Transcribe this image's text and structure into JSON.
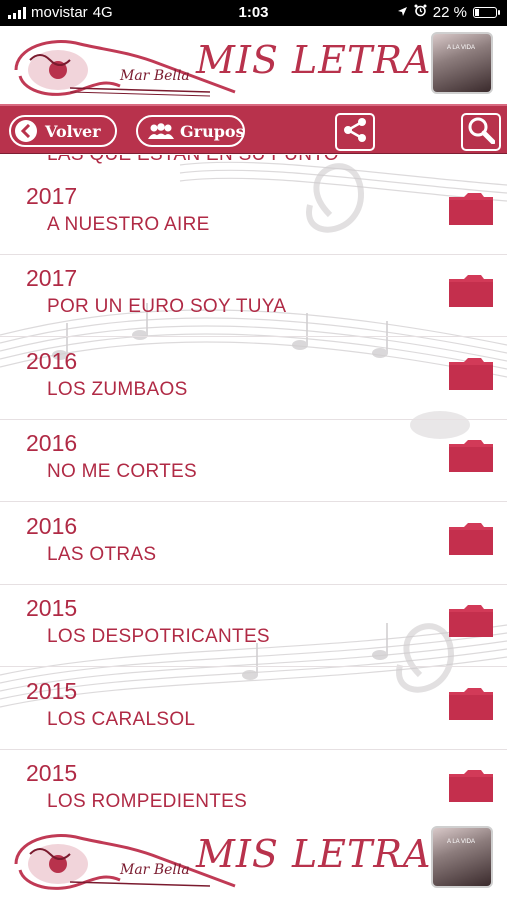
{
  "status_bar": {
    "carrier": "movistar",
    "network": "4G",
    "time": "1:03",
    "battery_percent": "22 %",
    "battery_level": 0.22
  },
  "header": {
    "title": "MIS LETRAS",
    "logo_text": "Mar Bella",
    "cover_text": "A LA VIDA"
  },
  "toolbar": {
    "back_label": "Volver",
    "groups_label": "Grupos"
  },
  "list": {
    "partial_top_text": "LAS QUE ESTAN EN SU PUNTO",
    "items": [
      {
        "year": "2017",
        "name": "A NUESTRO AIRE"
      },
      {
        "year": "2017",
        "name": "POR UN EURO SOY TUYA"
      },
      {
        "year": "2016",
        "name": "LOS ZUMBAOS"
      },
      {
        "year": "2016",
        "name": "NO ME CORTES"
      },
      {
        "year": "2016",
        "name": "LAS OTRAS"
      },
      {
        "year": "2015",
        "name": "LOS DESPOTRICANTES"
      },
      {
        "year": "2015",
        "name": "LOS CARALSOL"
      },
      {
        "year": "2015",
        "name": "LOS ROMPEDIENTES"
      }
    ]
  },
  "footer": {
    "title": "MIS LETRAS"
  },
  "colors": {
    "accent": "#b8324c",
    "text": "#b02a45",
    "folder": "#d23a58"
  }
}
